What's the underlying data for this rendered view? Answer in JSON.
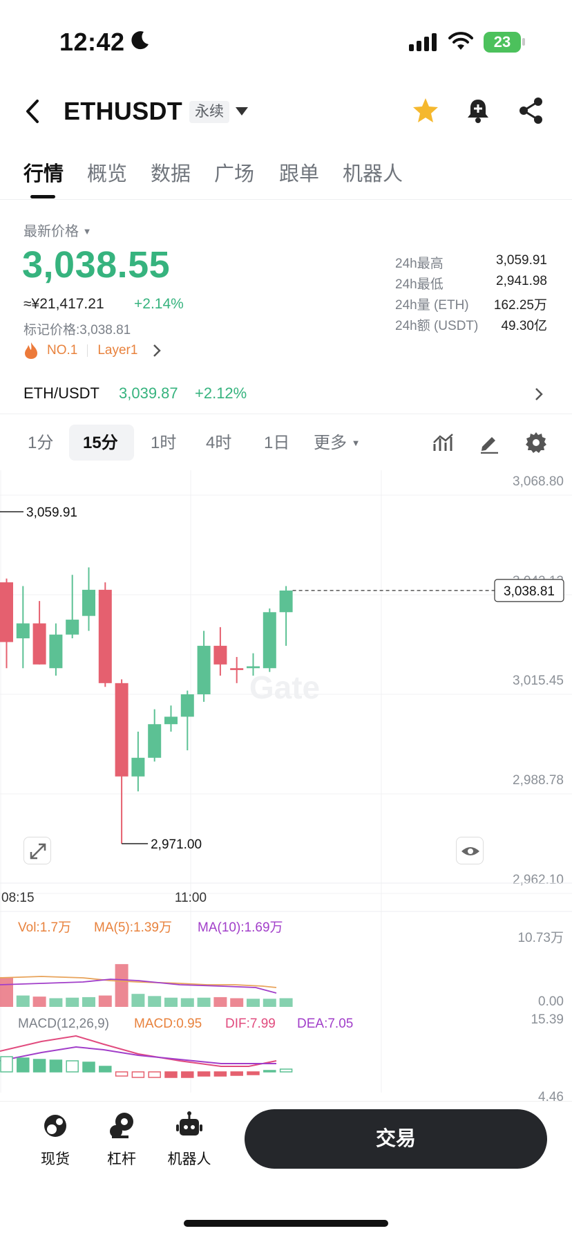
{
  "status_bar": {
    "time": "12:42",
    "battery": "23"
  },
  "header": {
    "title": "ETHUSDT",
    "tag": "永续"
  },
  "tabs": [
    {
      "label": "行情",
      "active": true
    },
    {
      "label": "概览"
    },
    {
      "label": "数据"
    },
    {
      "label": "广场"
    },
    {
      "label": "跟单"
    },
    {
      "label": "机器人"
    }
  ],
  "price": {
    "label": "最新价格",
    "last": "3,038.55",
    "cny": "≈¥21,417.21",
    "change": "+2.14%",
    "mark_label": "标记价格:",
    "mark_value": "3,038.81",
    "rank": "NO.1",
    "sector": "Layer1"
  },
  "stats": [
    {
      "label": "24h最高",
      "value": "3,059.91"
    },
    {
      "label": "24h最低",
      "value": "2,941.98"
    },
    {
      "label": "24h量 (ETH)",
      "value": "162.25万"
    },
    {
      "label": "24h额 (USDT)",
      "value": "49.30亿"
    }
  ],
  "spot": {
    "pair": "ETH/USDT",
    "price": "3,039.87",
    "change": "+2.12%"
  },
  "intervals": [
    {
      "label": "1分"
    },
    {
      "label": "15分",
      "active": true
    },
    {
      "label": "1时"
    },
    {
      "label": "4时"
    },
    {
      "label": "1日"
    },
    {
      "label": "更多"
    }
  ],
  "colors": {
    "up": "#5cc194",
    "down": "#e5606f",
    "text_up": "#36b37e",
    "accent": "#e8823d"
  },
  "chart_data": {
    "type": "candlestick",
    "y_ticks": [
      "3,068.80",
      "3,042.12",
      "3,015.45",
      "2,988.78",
      "2,962.10"
    ],
    "ylim": [
      2962.1,
      3068.8
    ],
    "x_ticks": [
      "08:15",
      "11:00"
    ],
    "high_label": "3,059.91",
    "low_label": "2,971.00",
    "current_label": "3,038.81",
    "watermark": "Gate",
    "candles": [
      {
        "o": 3041,
        "c": 3025,
        "h": 3042,
        "l": 3018
      },
      {
        "o": 3026,
        "c": 3030,
        "h": 3040,
        "l": 3018
      },
      {
        "o": 3030,
        "c": 3019,
        "h": 3036,
        "l": 3019
      },
      {
        "o": 3018,
        "c": 3027,
        "h": 3030,
        "l": 3016
      },
      {
        "o": 3027,
        "c": 3031,
        "h": 3043,
        "l": 3026
      },
      {
        "o": 3032,
        "c": 3039,
        "h": 3045,
        "l": 3028
      },
      {
        "o": 3039,
        "c": 3014,
        "h": 3041,
        "l": 3013
      },
      {
        "o": 3014,
        "c": 2989,
        "h": 3015,
        "l": 2971
      },
      {
        "o": 2989,
        "c": 2994,
        "h": 3001,
        "l": 2985
      },
      {
        "o": 2994,
        "c": 3003,
        "h": 3007,
        "l": 2993
      },
      {
        "o": 3003,
        "c": 3005,
        "h": 3008,
        "l": 3001
      },
      {
        "o": 3005,
        "c": 3011,
        "h": 3012,
        "l": 2996
      },
      {
        "o": 3011,
        "c": 3024,
        "h": 3028,
        "l": 3009
      },
      {
        "o": 3024,
        "c": 3019,
        "h": 3029,
        "l": 3016
      },
      {
        "o": 3018,
        "c": 3017.5,
        "h": 3021,
        "l": 3014
      },
      {
        "o": 3018,
        "c": 3018.5,
        "h": 3022,
        "l": 3016
      },
      {
        "o": 3018,
        "c": 3033,
        "h": 3034,
        "l": 3017
      },
      {
        "o": 3033,
        "c": 3038.8,
        "h": 3040,
        "l": 3024
      }
    ],
    "volume": {
      "labels": {
        "vol": "Vol:1.7万",
        "ma5": "MA(5):1.39万",
        "ma10": "MA(10):1.69万"
      },
      "y_ticks": [
        "10.73万",
        "0.00"
      ],
      "ylim": [
        0,
        10.73
      ],
      "values": [
        5.5,
        2.1,
        1.9,
        1.6,
        1.7,
        1.8,
        2.1,
        7.9,
        2.4,
        2.0,
        1.7,
        1.6,
        1.7,
        1.8,
        1.6,
        1.5,
        1.5,
        1.6
      ]
    },
    "macd": {
      "labels": {
        "name": "MACD(12,26,9)",
        "macd": "MACD:0.95",
        "dif": "DIF:7.99",
        "dea": "DEA:7.05"
      },
      "y_ticks": [
        "15.39",
        "4.46"
      ]
    }
  },
  "bottom_nav": [
    {
      "label": "现货"
    },
    {
      "label": "杠杆"
    },
    {
      "label": "机器人"
    }
  ],
  "trade_button": "交易"
}
